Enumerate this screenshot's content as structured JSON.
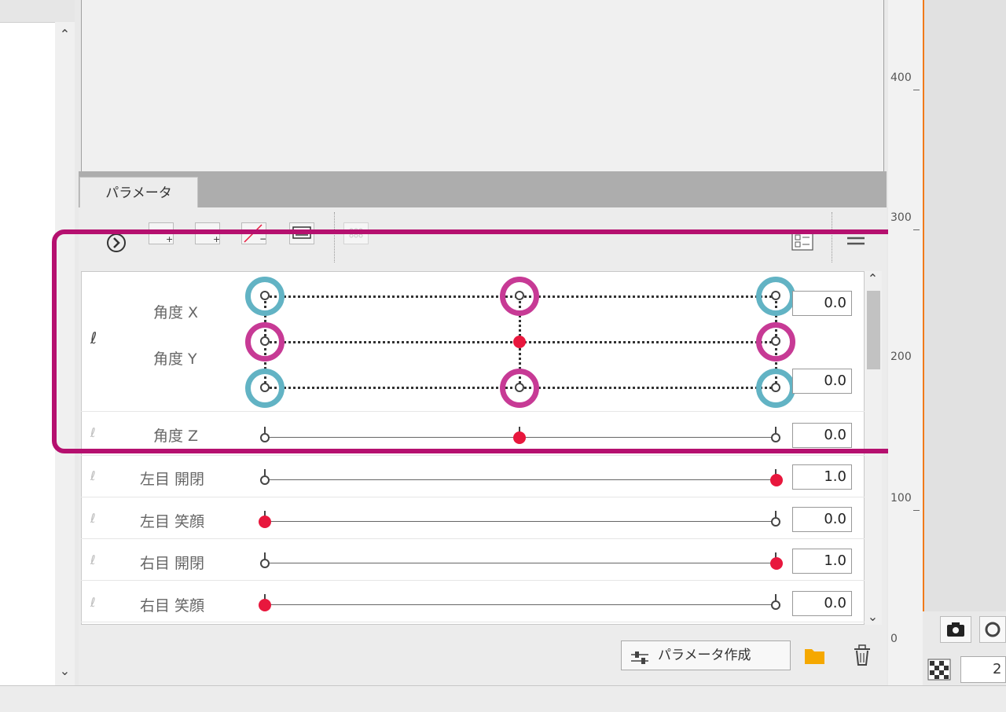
{
  "tab": {
    "label": "パラメータ"
  },
  "toolbar": {
    "icons": [
      "circle-chevron-icon",
      "add-key-2-icon",
      "add-key-3-icon",
      "delete-keys-icon",
      "keyform-icon",
      "grid-disabled-icon",
      "list-view-icon",
      "menu-icon"
    ]
  },
  "params": [
    {
      "name": "角度 X",
      "value": "0.0"
    },
    {
      "name": "角度 Y",
      "value": "0.0"
    },
    {
      "name": "角度 Z",
      "value": "0.0"
    },
    {
      "name": "左目 開閉",
      "value": "1.0"
    },
    {
      "name": "左目 笑顔",
      "value": "0.0"
    },
    {
      "name": "右目 開閉",
      "value": "1.0"
    },
    {
      "name": "右目 笑顔",
      "value": "0.0"
    }
  ],
  "footer": {
    "create_label": "パラメータ作成"
  },
  "ruler": {
    "labels": [
      "400",
      "300",
      "200",
      "100",
      "0"
    ]
  },
  "right": {
    "zoom_value": "2"
  },
  "colors": {
    "highlight": "#b5106f",
    "teal": "#62b3c4",
    "pink": "#c73a95",
    "active_key": "#e8173d"
  }
}
